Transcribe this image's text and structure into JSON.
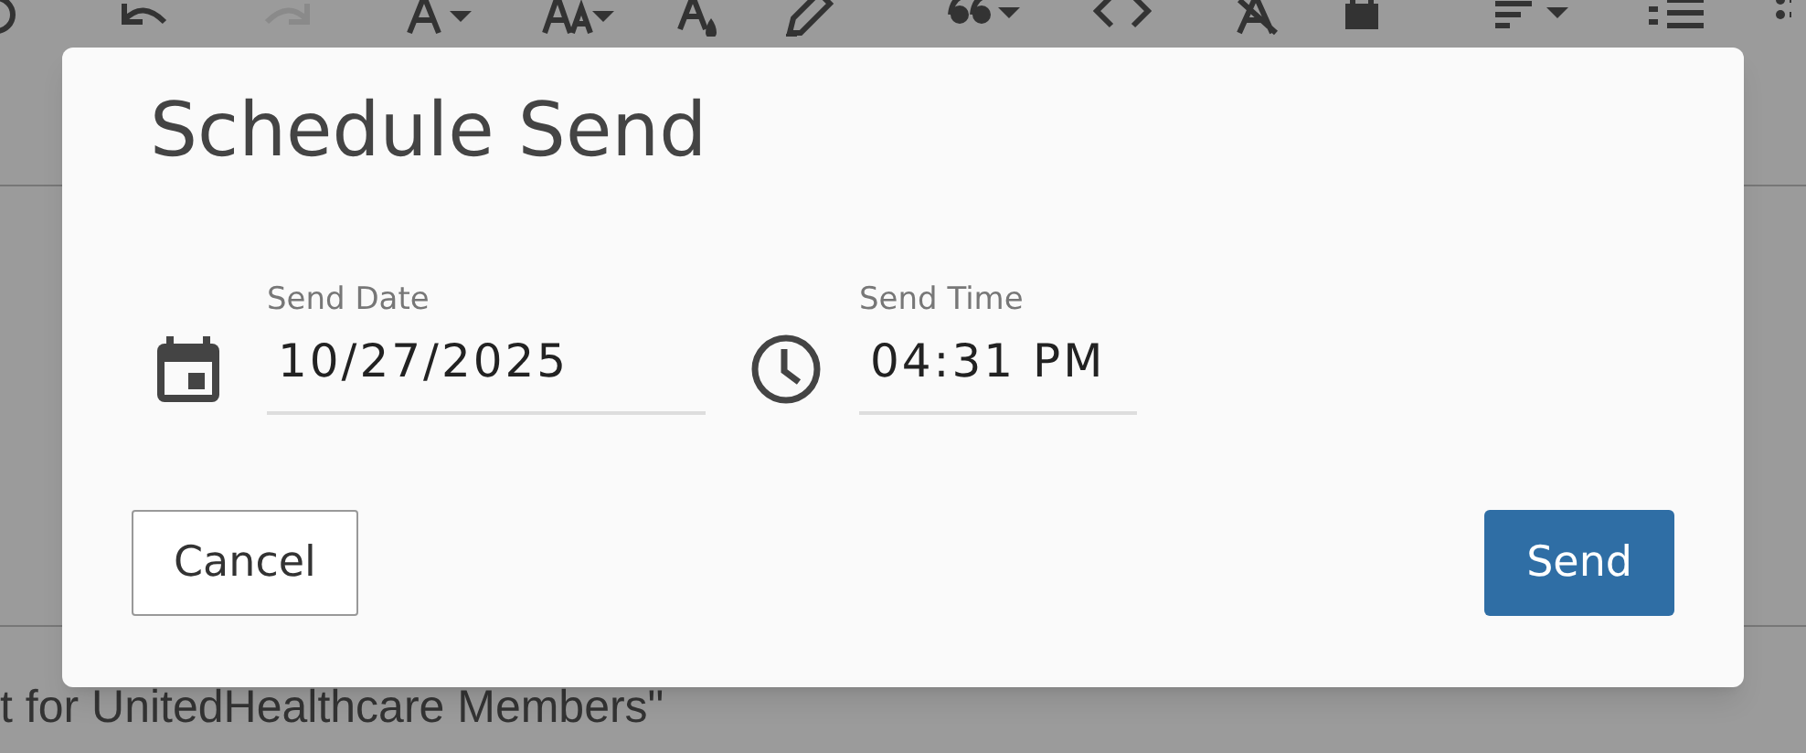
{
  "toolbar": [
    {
      "kind": "emoji",
      "disabled": false
    },
    {
      "kind": "undo",
      "disabled": false
    },
    {
      "kind": "redo",
      "disabled": true
    },
    {
      "kind": "font",
      "disabled": false
    },
    {
      "kind": "size",
      "disabled": false
    },
    {
      "kind": "color",
      "disabled": false
    },
    {
      "kind": "highlight",
      "disabled": false
    },
    {
      "kind": "quote",
      "disabled": false
    },
    {
      "kind": "code",
      "disabled": false
    },
    {
      "kind": "clear",
      "disabled": false
    },
    {
      "kind": "lock",
      "disabled": false
    },
    {
      "kind": "align",
      "disabled": false
    },
    {
      "kind": "numbered",
      "disabled": false
    },
    {
      "kind": "bullets",
      "disabled": false
    }
  ],
  "document": {
    "text": "t for UnitedHealthcare Members\""
  },
  "dialog": {
    "title": "Schedule Send",
    "fields": [
      {
        "kind": "date",
        "label": "Send Date",
        "value": "10/27/2025"
      },
      {
        "kind": "time",
        "label": "Send Time",
        "value": "04:31 PM"
      }
    ],
    "buttons": [
      {
        "kind": "secondary",
        "label": "Cancel"
      },
      {
        "kind": "primary",
        "label": "Send"
      }
    ]
  }
}
